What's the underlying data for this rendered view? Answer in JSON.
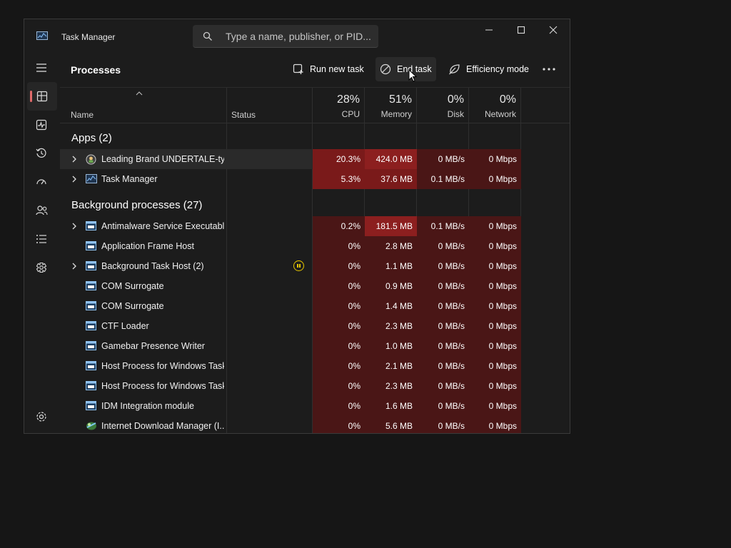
{
  "window": {
    "title": "Task Manager",
    "search_placeholder": "Type a name, publisher, or PID..."
  },
  "nav": [
    {
      "icon": "hamburger-menu-icon"
    },
    {
      "icon": "processes-icon",
      "active": true
    },
    {
      "icon": "performance-icon"
    },
    {
      "icon": "app-history-icon"
    },
    {
      "icon": "startup-apps-icon"
    },
    {
      "icon": "users-icon"
    },
    {
      "icon": "details-icon"
    },
    {
      "icon": "services-icon"
    },
    {
      "icon": "settings-icon"
    }
  ],
  "commandbar": {
    "page_title": "Processes",
    "run_new_task": "Run new task",
    "end_task": "End task",
    "efficiency_mode": "Efficiency mode"
  },
  "columns": {
    "name": "Name",
    "status": "Status",
    "cpu": {
      "pct": "28%",
      "label": "CPU"
    },
    "memory": {
      "pct": "51%",
      "label": "Memory"
    },
    "disk": {
      "pct": "0%",
      "label": "Disk"
    },
    "network": {
      "pct": "0%",
      "label": "Network"
    }
  },
  "groups": {
    "apps": "Apps (2)",
    "background": "Background processes (27)"
  },
  "apps": [
    {
      "name": "Leading Brand UNDERTALE-ty...",
      "cpu": "20.3%",
      "memory": "424.0 MB",
      "disk": "0 MB/s",
      "network": "0 Mbps",
      "expandable": true,
      "icon": "undertale-app-icon"
    },
    {
      "name": "Task Manager",
      "cpu": "5.3%",
      "memory": "37.6 MB",
      "disk": "0.1 MB/s",
      "network": "0 Mbps",
      "expandable": true,
      "icon": "task-manager-icon"
    }
  ],
  "background": [
    {
      "name": "Antimalware Service Executable",
      "cpu": "0.2%",
      "memory": "181.5 MB",
      "disk": "0.1 MB/s",
      "network": "0 Mbps",
      "expandable": true
    },
    {
      "name": "Application Frame Host",
      "cpu": "0%",
      "memory": "2.8 MB",
      "disk": "0 MB/s",
      "network": "0 Mbps"
    },
    {
      "name": "Background Task Host (2)",
      "cpu": "0%",
      "memory": "1.1 MB",
      "disk": "0 MB/s",
      "network": "0 Mbps",
      "expandable": true,
      "status": "suspended"
    },
    {
      "name": "COM Surrogate",
      "cpu": "0%",
      "memory": "0.9 MB",
      "disk": "0 MB/s",
      "network": "0 Mbps"
    },
    {
      "name": "COM Surrogate",
      "cpu": "0%",
      "memory": "1.4 MB",
      "disk": "0 MB/s",
      "network": "0 Mbps"
    },
    {
      "name": "CTF Loader",
      "cpu": "0%",
      "memory": "2.3 MB",
      "disk": "0 MB/s",
      "network": "0 Mbps"
    },
    {
      "name": "Gamebar Presence Writer",
      "cpu": "0%",
      "memory": "1.0 MB",
      "disk": "0 MB/s",
      "network": "0 Mbps"
    },
    {
      "name": "Host Process for Windows Tasks",
      "cpu": "0%",
      "memory": "2.1 MB",
      "disk": "0 MB/s",
      "network": "0 Mbps"
    },
    {
      "name": "Host Process for Windows Tasks",
      "cpu": "0%",
      "memory": "2.3 MB",
      "disk": "0 MB/s",
      "network": "0 Mbps"
    },
    {
      "name": "IDM Integration module",
      "cpu": "0%",
      "memory": "1.6 MB",
      "disk": "0 MB/s",
      "network": "0 Mbps"
    },
    {
      "name": "Internet Download Manager (I...",
      "cpu": "0%",
      "memory": "5.6 MB",
      "disk": "0 MB/s",
      "network": "0 Mbps",
      "icon": "idm-icon"
    }
  ],
  "colors": {
    "heat_strong": "#7a1a1a",
    "heat_high": "#8c1f1f",
    "heat_med": "#5c1818",
    "heat_low": "#4a1616",
    "accent": "#e06a6a"
  }
}
